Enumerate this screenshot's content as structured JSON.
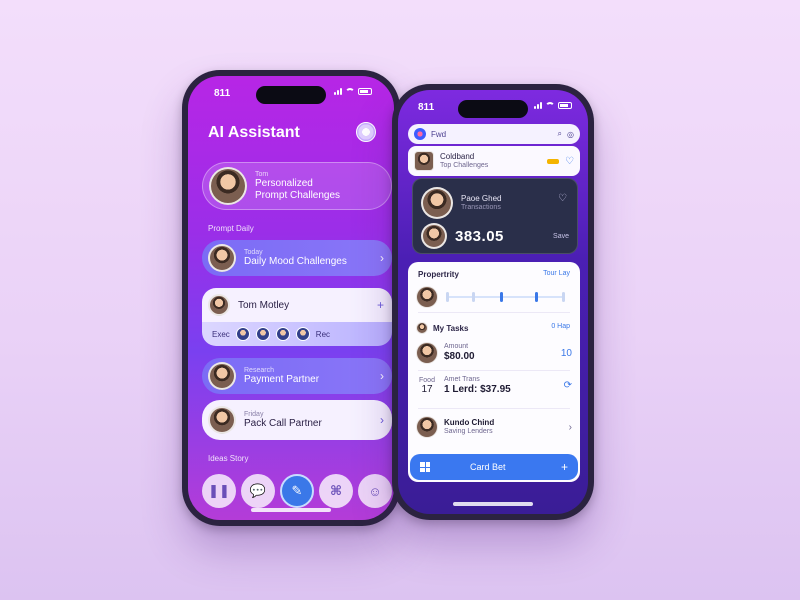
{
  "phone1": {
    "time": "811",
    "title": "AI Assistant",
    "hero": {
      "overline": "Tom",
      "line1": "Personalized",
      "line2": "Prompt Challenges"
    },
    "section_label": "Prompt Daily",
    "cards": [
      {
        "overline": "Today",
        "label": "Daily Mood Challenges",
        "style": "violet"
      },
      {
        "label": "Tom Motley",
        "style": "white"
      },
      {
        "overline": "Research",
        "label": "Payment Partner",
        "style": "violet"
      },
      {
        "overline": "Friday",
        "label": "Pack Call Partner",
        "style": "white"
      }
    ],
    "mini_row_label": "Exec",
    "mini_row_trailing": "Rec",
    "footer_label": "Ideas Story",
    "dock_icons": [
      "pause-icon",
      "chat-icon",
      "edit-icon",
      "tag-icon",
      "emoji-icon"
    ]
  },
  "phone2": {
    "time": "811",
    "search_label": "Fwd",
    "notification": {
      "title": "Coldband",
      "subtitle": "Top Challenges"
    },
    "dark_card": {
      "name": "Paoe Ghed",
      "sub": "Transactions",
      "amount": "383.05",
      "link": "Save"
    },
    "panel_title": "Propertrity",
    "panel_action": "Tour Lay",
    "sliders": [
      0.46,
      0.75
    ],
    "tasks_title": "My Tasks",
    "tasks_action": "0 Hap",
    "transactions": [
      {
        "label": "Amount",
        "value": "$80.00",
        "action": "10"
      },
      {
        "prefix_top": "Food",
        "prefix": "17",
        "label": "Amet Trans",
        "value": "1 Lerd: $37.95",
        "action": "⟳"
      },
      {
        "label": "Kundo Chind",
        "sub": "Saving Lenders",
        "action": "›"
      }
    ],
    "cta_label": "Card Bet",
    "colors": {
      "accent": "#3a78f0",
      "violet": "#7b6cf5"
    }
  }
}
